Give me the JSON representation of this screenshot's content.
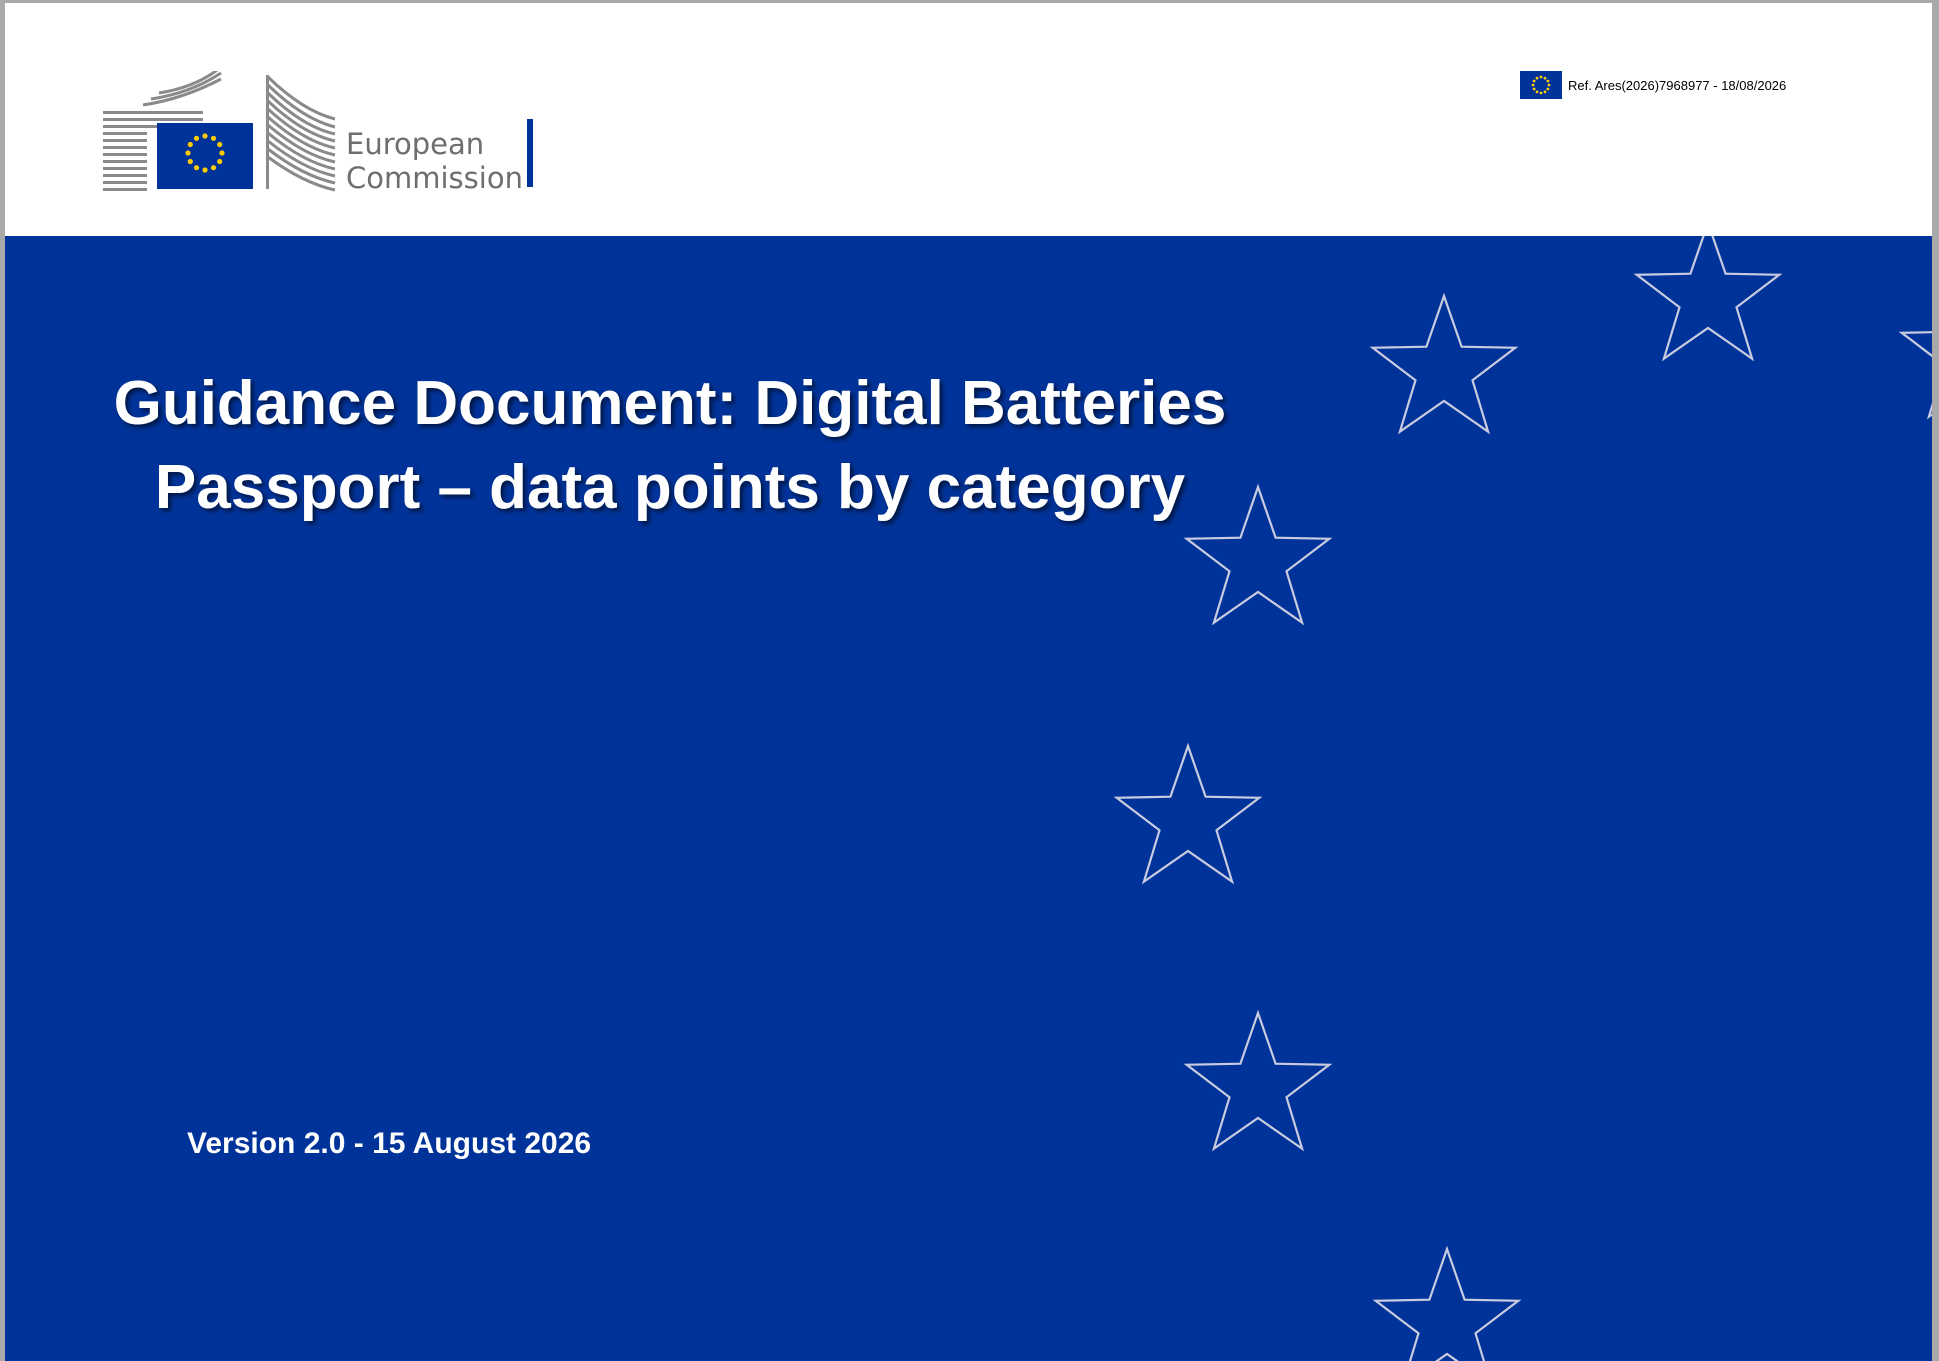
{
  "header": {
    "logo": {
      "line1": "European",
      "line2": "Commission"
    },
    "reference": "Ref. Ares(2026)7968977 - 18/08/2026"
  },
  "cover": {
    "title_line1": "Guidance Document: Digital Batteries",
    "title_line2": "Passport – data points by category",
    "version": "Version 2.0 - 15 August 2026"
  },
  "colors": {
    "eu_blue": "#003399",
    "eu_yellow": "#FFCC00",
    "logo_grey": "#6e6e6e",
    "star_outline": "#c9cce0"
  },
  "icons": {
    "emblem": "european-commission-logo",
    "flag": "eu-flag-icon",
    "decoration": "star-outline-icon"
  }
}
